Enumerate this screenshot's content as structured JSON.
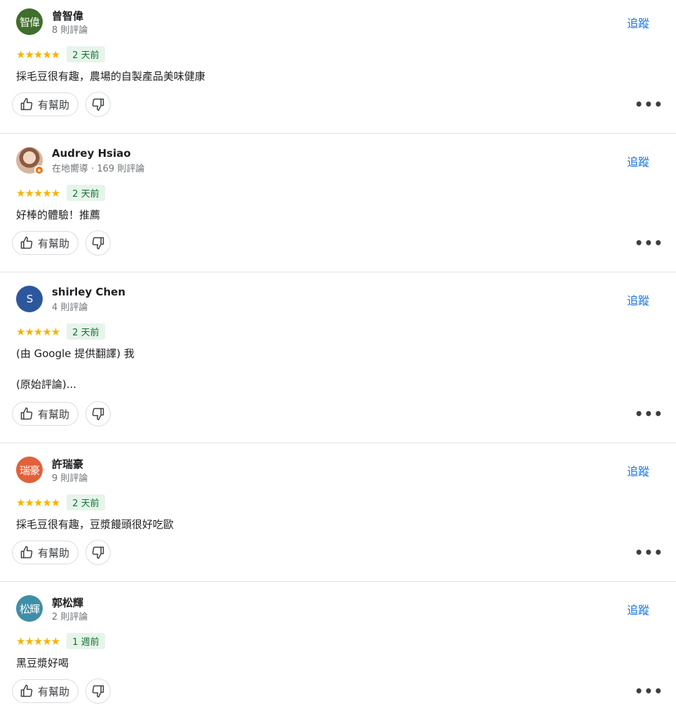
{
  "reviews": [
    {
      "avatar_initials": "智偉",
      "avatar_color": "#3f6f2a",
      "name": "曾智偉",
      "meta": "8 則評論",
      "stars": "★★★★★",
      "rating": 5,
      "time": "2 天前",
      "text_lines": [
        "採毛豆很有趣，農場的自製產品美味健康"
      ],
      "follow_label": "追蹤",
      "helpful_label": "有幫助"
    },
    {
      "avatar_initials": "",
      "avatar_color": "#c9a48a",
      "local_guide": true,
      "name": "Audrey Hsiao",
      "meta": "在地嚮導 · 169 則評論",
      "stars": "★★★★★",
      "rating": 5,
      "time": "2 天前",
      "text_lines": [
        "好棒的體驗！推薦"
      ],
      "follow_label": "追蹤",
      "helpful_label": "有幫助"
    },
    {
      "avatar_initials": "S",
      "avatar_color": "#2d579d",
      "name": "shirley Chen",
      "meta": "4 則評論",
      "stars": "★★★★★",
      "rating": 5,
      "time": "2 天前",
      "text_lines": [
        "(由 Google 提供翻譯) 我",
        "",
        "(原始評論)..."
      ],
      "follow_label": "追蹤",
      "helpful_label": "有幫助"
    },
    {
      "avatar_initials": "瑞豪",
      "avatar_color": "#e0613b",
      "name": "許瑞豪",
      "meta": "9 則評論",
      "stars": "★★★★★",
      "rating": 5,
      "time": "2 天前",
      "text_lines": [
        "採毛豆很有趣，豆漿饅頭很好吃歐"
      ],
      "follow_label": "追蹤",
      "helpful_label": "有幫助"
    },
    {
      "avatar_initials": "松輝",
      "avatar_color": "#3f8fa6",
      "name": "郭松輝",
      "meta": "2 則評論",
      "stars": "★★★★★",
      "rating": 5,
      "time": "1 週前",
      "text_lines": [
        "黑豆漿好喝"
      ],
      "follow_label": "追蹤",
      "helpful_label": "有幫助"
    }
  ],
  "icons": {
    "thumbs_up": "thumbs-up-icon",
    "thumbs_down": "thumbs-down-icon",
    "more": "more-horizontal-icon"
  },
  "more_label": "•••"
}
